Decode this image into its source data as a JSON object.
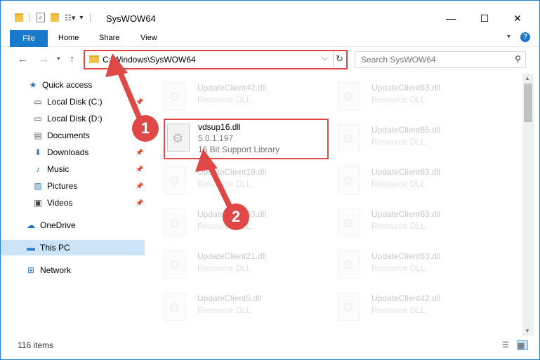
{
  "window": {
    "title": "SysWOW64",
    "controls": {
      "minimize": "—",
      "maximize": "☐",
      "close": "✕"
    }
  },
  "ribbon": {
    "tabs": [
      "File",
      "Home",
      "Share",
      "View"
    ],
    "collapse_icon": "chevron-down-icon",
    "help_icon": "?"
  },
  "address": {
    "path": "C:\\Windows\\SysWOW64",
    "search_placeholder": "Search SysWOW64"
  },
  "nav": {
    "items": [
      {
        "label": "Quick access",
        "icon": "★",
        "pinned": false
      },
      {
        "label": "Local Disk (C:)",
        "icon": "▭",
        "pinned": true
      },
      {
        "label": "Local Disk (D:)",
        "icon": "▭",
        "pinned": true
      },
      {
        "label": "Documents",
        "icon": "▤",
        "pinned": true
      },
      {
        "label": "Downloads",
        "icon": "⬇",
        "pinned": true
      },
      {
        "label": "Music",
        "icon": "♪",
        "pinned": true
      },
      {
        "label": "Pictures",
        "icon": "▨",
        "pinned": true
      },
      {
        "label": "Videos",
        "icon": "▣",
        "pinned": true
      },
      {
        "label": "OneDrive",
        "icon": "☁",
        "pinned": false
      },
      {
        "label": "This PC",
        "icon": "▬",
        "pinned": false,
        "selected": true
      },
      {
        "label": "Network",
        "icon": "⊞",
        "pinned": false
      }
    ]
  },
  "files": {
    "highlighted": {
      "name": "vdsup16.dll",
      "version": "5.0.1.197",
      "description": "16 Bit Support Library"
    },
    "left_column": [
      {
        "name": "UpdateClient42.dll",
        "type": "Resource DLL"
      },
      {
        "name": "UpdateClient19.dll",
        "type": "Resource DLL"
      },
      {
        "name": "UpdateClient63.dll",
        "type": "Resource DLL"
      },
      {
        "name": "UpdateClient21.dll",
        "type": "Resource DLL"
      },
      {
        "name": "UpdateClient5.dll",
        "type": "Resource DLL"
      }
    ],
    "right_column": [
      {
        "name": "UpdateClient63.dll",
        "type": "Resource DLL"
      },
      {
        "name": "UpdateClient65.dll",
        "type": "Resource DLL"
      },
      {
        "name": "UpdateClient63.dll",
        "type": "Resource DLL"
      },
      {
        "name": "UpdateClient63.dll",
        "type": "Resource DLL"
      },
      {
        "name": "UpdateClient63.dll",
        "type": "Resource DLL"
      },
      {
        "name": "UpdateClient42.dll",
        "type": "Resource DLL"
      }
    ]
  },
  "status": {
    "count": "116 items"
  },
  "annotations": {
    "step1": "1",
    "step2": "2",
    "color": "#e04848"
  }
}
